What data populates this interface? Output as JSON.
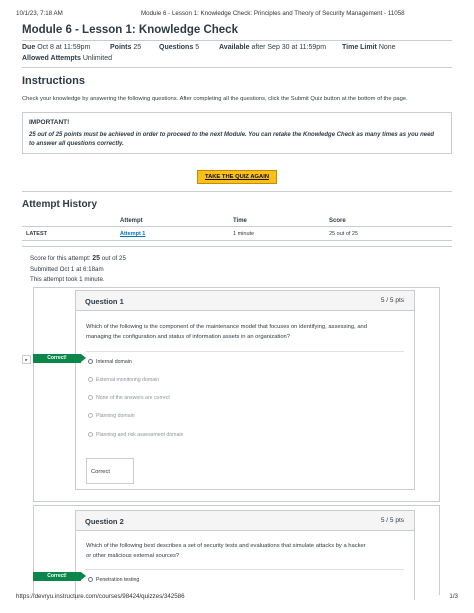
{
  "print": {
    "date": "10/1/23, 7:18 AM",
    "doc_title": "Module 6 - Lesson 1: Knowledge Check: Principles and Theory of Security Management - 11058",
    "url": "https://devryu.instructure.com/courses/98424/quizzes/342586",
    "page": "1/3"
  },
  "quiz": {
    "title": "Module 6 - Lesson 1: Knowledge Check",
    "due_label": "Due",
    "due_value": "Oct 8 at 11:59pm",
    "points_label": "Points",
    "points_value": "25",
    "questions_label": "Questions",
    "questions_value": "5",
    "available_label": "Available",
    "available_value": "after Sep 30 at 11:59pm",
    "time_limit_label": "Time Limit",
    "time_limit_value": "None",
    "attempts_label": "Allowed Attempts",
    "attempts_value": "Unlimited"
  },
  "instructions": {
    "heading": "Instructions",
    "text": "Check your knowledge by answering the following questions. After completing all the questions, click the Submit Quiz button at the bottom of the page.",
    "important_heading": "IMPORTANT!",
    "important_text": "25 out of 25 points must be achieved in order to proceed to the next Module. You can retake the Knowledge Check as many times as you need to answer all questions correctly."
  },
  "retake_button": "TAKE THE QUIZ AGAIN",
  "attempt_history": {
    "heading": "Attempt History",
    "col_attempt": "Attempt",
    "col_time": "Time",
    "col_score": "Score",
    "row_label": "LATEST",
    "row_attempt": "Attempt 1",
    "row_time": "1 minute",
    "row_score": "25 out of 25"
  },
  "attempt_summary": {
    "score_prefix": "Score for this attempt:",
    "score_value": "25",
    "score_suffix": "out of 25",
    "submitted": "Submitted Oct 1 at 6:18am",
    "duration": "This attempt took 1 minute."
  },
  "questions": [
    {
      "label": "Question 1",
      "points": "5 / 5 pts",
      "text_line1": "Which of the following is the component of the maintenance model that focuses on identifying, assessing, and",
      "text_line2": "managing the configuration and status of information assets in an organization?",
      "tag": "Correct!",
      "answers": [
        "Internal domain",
        "External monitoring domain",
        "None of the answers are correct",
        "Planning domain",
        "Planning and risk assessment domain"
      ],
      "comment": "Correct"
    },
    {
      "label": "Question 2",
      "points": "5 / 5 pts",
      "text_line1": "Which of the following best describes a set of security tests and evaluations that simulate attacks by a hacker",
      "text_line2": "or other malicious external sources?",
      "tag": "Correct!",
      "answers": [
        "Penetration testing"
      ]
    }
  ],
  "icons": {
    "expand": "▸"
  }
}
